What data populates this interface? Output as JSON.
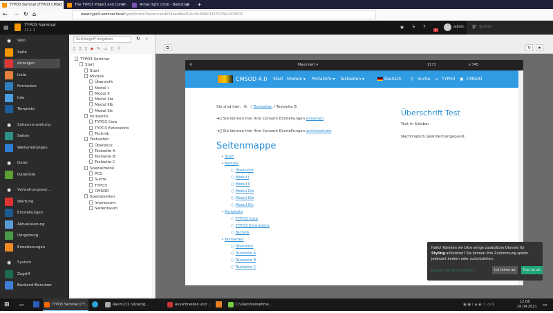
{
  "browser": {
    "tabs": [
      "TYPO3 Seminar [TYPO3 CMS 1",
      "The TYPO3 Project and Comm",
      "Arrow right circle - Bootstrap"
    ],
    "url_host": "www.typo3-seminar.local",
    "url_path": "/typo3/main?token=e4d634eee0bef12cc5e3f95c332767f9e7474501"
  },
  "header": {
    "site": "TYPO3 Seminar",
    "version": "11.1.1",
    "user": "admin",
    "search_placeholder": "Suchen",
    "badge": "1"
  },
  "modules": [
    {
      "label": "Web",
      "group": true
    },
    {
      "label": "Seite",
      "color": "#f49700"
    },
    {
      "label": "Anzeigen",
      "color": "#dd3737",
      "selected": true
    },
    {
      "label": "Liste",
      "color": "#e58140"
    },
    {
      "label": "Formulare",
      "color": "#317fbd"
    },
    {
      "label": "Info",
      "color": "#4b9de0"
    },
    {
      "label": "Template",
      "color": "#1b5e9c"
    },
    {
      "label": "Seitenverwaltung",
      "group": true
    },
    {
      "label": "Seiten",
      "color": "#2e8f88"
    },
    {
      "label": "Weiterleitungen",
      "color": "#2e7dd1"
    },
    {
      "label": "Datei",
      "group": true
    },
    {
      "label": "Dateiliste",
      "color": "#5f9e36"
    },
    {
      "label": "Verwaltungswer...",
      "group": true
    },
    {
      "label": "Wartung",
      "color": "#d33"
    },
    {
      "label": "Einstellungen",
      "color": "#1d5a8e"
    },
    {
      "label": "Aktualisierung",
      "color": "#5b9bd5"
    },
    {
      "label": "Umgebung",
      "color": "#4a9a47"
    },
    {
      "label": "Erweiterungen",
      "color": "#f08b26"
    },
    {
      "label": "System",
      "group": true
    },
    {
      "label": "Zugriff",
      "color": "#1e6b4f"
    },
    {
      "label": "Backend-Benutzer",
      "color": "#3d7ed6"
    }
  ],
  "tree": {
    "search_placeholder": "Suchbegriff eingeben",
    "nodes": [
      {
        "label": "TYPO3 Seminar",
        "level": 0
      },
      {
        "label": "Start",
        "level": 1
      },
      {
        "label": "Start",
        "level": 2
      },
      {
        "label": "Module",
        "level": 2
      },
      {
        "label": "Übersicht",
        "level": 3
      },
      {
        "label": "Modul I",
        "level": 3
      },
      {
        "label": "Modul II",
        "level": 3
      },
      {
        "label": "Modul IIIa",
        "level": 3
      },
      {
        "label": "Modul IIIb",
        "level": 3
      },
      {
        "label": "Modul IIIc",
        "level": 3
      },
      {
        "label": "Portalinfo",
        "level": 2
      },
      {
        "label": "TYPO3 Core",
        "level": 3
      },
      {
        "label": "TYPO3 Extensions",
        "level": 3
      },
      {
        "label": "Technik",
        "level": 3
      },
      {
        "label": "Testseiten",
        "level": 2
      },
      {
        "label": "Überblick",
        "level": 3
      },
      {
        "label": "Testseite A",
        "level": 3
      },
      {
        "label": "Testseite B",
        "level": 3,
        "selected": true
      },
      {
        "label": "Testseite C",
        "level": 3
      },
      {
        "label": "Spezialmenü",
        "level": 2
      },
      {
        "label": "PCS",
        "level": 3
      },
      {
        "label": "Suche",
        "level": 3
      },
      {
        "label": "TYPO3",
        "level": 3
      },
      {
        "label": "CMSOD",
        "level": 3
      },
      {
        "label": "Spezialseiten",
        "level": 2
      },
      {
        "label": "Impressum",
        "level": 3
      },
      {
        "label": "Seitenbaum",
        "level": 3
      }
    ]
  },
  "preview": {
    "mode": "Maximiert",
    "width": "1171",
    "height": "x 745"
  },
  "site": {
    "brand": "CMSOD 4.0",
    "nav": [
      "Start",
      "Module ▾",
      "Portalinfo ▾",
      "Testseiten ▾"
    ],
    "lang": "Deutsch",
    "search": "Suche",
    "typo3": "TYPO3",
    "cmsod": "CMSOD",
    "breadcrumb_label": "Sie sind hier:",
    "crumb1": "Testseiten",
    "crumb2": "Testseite B",
    "consent1": "Sie können hier Ihre Consent Einstellungen ",
    "consent1_link": "einsehen",
    "consent2": "Sie können hier Ihre Consent Einstellungen ",
    "consent2_link": "zurücksetzen",
    "sitemap_title": "Seitenmappe",
    "sitemap": [
      {
        "label": "Start",
        "level": 0
      },
      {
        "label": "Module",
        "level": 0
      },
      {
        "label": "Übersicht",
        "level": 1
      },
      {
        "label": "Modul I",
        "level": 1
      },
      {
        "label": "Modul II",
        "level": 1
      },
      {
        "label": "Modul IIIa",
        "level": 1
      },
      {
        "label": "Modul IIIb",
        "level": 1
      },
      {
        "label": "Modul IIIc",
        "level": 1
      },
      {
        "label": "Portalinfo",
        "level": 0
      },
      {
        "label": "TYPO3 Core",
        "level": 1
      },
      {
        "label": "TYPO3 Extensions",
        "level": 1
      },
      {
        "label": "Technik",
        "level": 1
      },
      {
        "label": "Testseiten",
        "level": 0
      },
      {
        "label": "Überblick",
        "level": 1
      },
      {
        "label": "Testseite A",
        "level": 1
      },
      {
        "label": "Testseite B",
        "level": 1
      },
      {
        "label": "Testseite C",
        "level": 1
      }
    ],
    "side_title": "Überschrift Test",
    "side_text1": "Text in Sidebar",
    "side_text2": "Nachträglich geändert/angepasst."
  },
  "cookie": {
    "text1": "Hallo! Könnten wir bitte einige zusätzliche Dienste für ",
    "bold": "Styling",
    "text2": " aktivieren? Sie können Ihre Zustimmung später jederzeit ändern oder zurückziehen.",
    "more": "Lassen Sie mich wählen...",
    "decline": "Ich lehne ab",
    "accept": "Das ist ok"
  },
  "taskbar": {
    "items": [
      "TYPO3 Seminar [TY...",
      "Raum211 (\\\\User\\g...",
      "Ausschneiden und ...",
      "C:\\Users\\teilnehme..."
    ],
    "time": "12:08",
    "date": "16.04.2021"
  }
}
